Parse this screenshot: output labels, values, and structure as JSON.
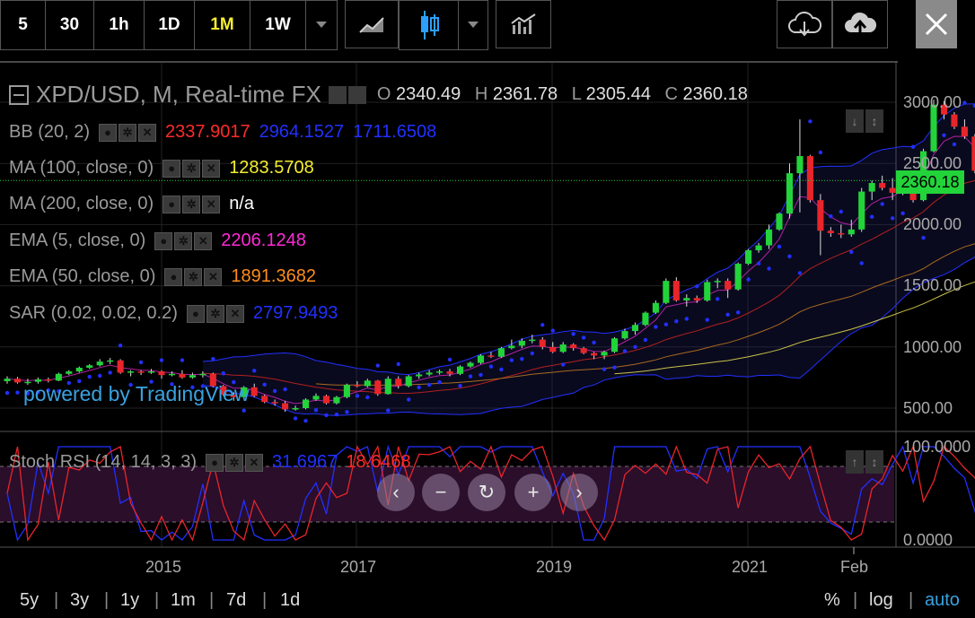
{
  "toolbar": {
    "intervals": [
      {
        "label": "5",
        "active": false
      },
      {
        "label": "30",
        "active": false
      },
      {
        "label": "1h",
        "active": false
      },
      {
        "label": "1D",
        "active": false
      },
      {
        "label": "1M",
        "active": true
      },
      {
        "label": "1W",
        "active": false
      }
    ]
  },
  "header": {
    "symbol": "XPD/USD, M, Real-time FX",
    "open_label": "O",
    "open": "2340.49",
    "high_label": "H",
    "high": "2361.78",
    "low_label": "L",
    "low": "2305.44",
    "close_label": "C",
    "close": "2360.18"
  },
  "indicators": [
    {
      "name": "BB (20, 2)",
      "values": [
        {
          "text": "2337.9017",
          "color": "#ff2a2a"
        },
        {
          "text": "2964.1527",
          "color": "#2230ff"
        },
        {
          "text": "1711.6508",
          "color": "#2230ff"
        }
      ]
    },
    {
      "name": "MA (100, close, 0)",
      "values": [
        {
          "text": "1283.5708",
          "color": "#f5ef2d"
        }
      ]
    },
    {
      "name": "MA (200, close, 0)",
      "values": [
        {
          "text": "n/a",
          "color": "#ffffff"
        }
      ]
    },
    {
      "name": "EMA (5, close, 0)",
      "values": [
        {
          "text": "2206.1248",
          "color": "#ff2ad8"
        }
      ]
    },
    {
      "name": "EMA (50, close, 0)",
      "values": [
        {
          "text": "1891.3682",
          "color": "#ff8c1a"
        }
      ]
    },
    {
      "name": "SAR (0.02, 0.02, 0.2)",
      "values": [
        {
          "text": "2797.9493",
          "color": "#2230ff"
        }
      ]
    }
  ],
  "stoch": {
    "name": "Stoch RSI (14, 14, 3, 3)",
    "k": "31.6967",
    "k_color": "#2230ff",
    "d": "18.6468",
    "d_color": "#ff2a2a"
  },
  "watermark": "powered by TradingView",
  "last_price": "2360.18",
  "price_axis": [
    "3000.00",
    "2500.00",
    "2000.00",
    "1500.00",
    "1000.00",
    "500.00"
  ],
  "stoch_axis": [
    "100.0000",
    "0.0000"
  ],
  "time_axis": [
    "2015",
    "2017",
    "2019",
    "2021",
    "Feb"
  ],
  "range_bar": {
    "left": [
      "5y",
      "3y",
      "1y",
      "1m",
      "7d",
      "1d"
    ],
    "right": [
      "%",
      "log",
      "auto"
    ]
  },
  "colors": {
    "up": "#22d33a",
    "down": "#e8252a",
    "active_interval": "#f5ef2d",
    "auto": "#3aa2e0"
  },
  "chart_data": {
    "type": "candlestick",
    "symbol": "XPD/USD",
    "interval": "1M",
    "ylim": [
      350,
      3150
    ],
    "candles": [
      {
        "t": "2013-10",
        "o": 720,
        "h": 760,
        "l": 700,
        "c": 740
      },
      {
        "t": "2013-11",
        "o": 740,
        "h": 755,
        "l": 700,
        "c": 710
      },
      {
        "t": "2013-12",
        "o": 710,
        "h": 740,
        "l": 690,
        "c": 715
      },
      {
        "t": "2014-01",
        "o": 715,
        "h": 750,
        "l": 700,
        "c": 735
      },
      {
        "t": "2014-02",
        "o": 735,
        "h": 750,
        "l": 710,
        "c": 725
      },
      {
        "t": "2014-03",
        "o": 725,
        "h": 790,
        "l": 720,
        "c": 780
      },
      {
        "t": "2014-04",
        "o": 780,
        "h": 810,
        "l": 770,
        "c": 800
      },
      {
        "t": "2014-05",
        "o": 800,
        "h": 840,
        "l": 790,
        "c": 830
      },
      {
        "t": "2014-06",
        "o": 830,
        "h": 860,
        "l": 820,
        "c": 850
      },
      {
        "t": "2014-07",
        "o": 850,
        "h": 900,
        "l": 840,
        "c": 880
      },
      {
        "t": "2014-08",
        "o": 880,
        "h": 910,
        "l": 860,
        "c": 890
      },
      {
        "t": "2014-09",
        "o": 890,
        "h": 900,
        "l": 780,
        "c": 790
      },
      {
        "t": "2014-10",
        "o": 790,
        "h": 810,
        "l": 760,
        "c": 800
      },
      {
        "t": "2014-11",
        "o": 800,
        "h": 810,
        "l": 770,
        "c": 790
      },
      {
        "t": "2014-12",
        "o": 790,
        "h": 820,
        "l": 780,
        "c": 800
      },
      {
        "t": "2015-01",
        "o": 800,
        "h": 810,
        "l": 740,
        "c": 770
      },
      {
        "t": "2015-02",
        "o": 770,
        "h": 800,
        "l": 760,
        "c": 780
      },
      {
        "t": "2015-03",
        "o": 780,
        "h": 810,
        "l": 740,
        "c": 750
      },
      {
        "t": "2015-04",
        "o": 750,
        "h": 790,
        "l": 740,
        "c": 770
      },
      {
        "t": "2015-05",
        "o": 770,
        "h": 800,
        "l": 750,
        "c": 780
      },
      {
        "t": "2015-06",
        "o": 780,
        "h": 790,
        "l": 670,
        "c": 680
      },
      {
        "t": "2015-07",
        "o": 680,
        "h": 690,
        "l": 600,
        "c": 610
      },
      {
        "t": "2015-08",
        "o": 610,
        "h": 630,
        "l": 560,
        "c": 590
      },
      {
        "t": "2015-09",
        "o": 590,
        "h": 680,
        "l": 580,
        "c": 670
      },
      {
        "t": "2015-10",
        "o": 670,
        "h": 700,
        "l": 590,
        "c": 600
      },
      {
        "t": "2015-11",
        "o": 600,
        "h": 610,
        "l": 540,
        "c": 550
      },
      {
        "t": "2015-12",
        "o": 550,
        "h": 570,
        "l": 520,
        "c": 540
      },
      {
        "t": "2016-01",
        "o": 540,
        "h": 560,
        "l": 470,
        "c": 490
      },
      {
        "t": "2016-02",
        "o": 490,
        "h": 520,
        "l": 480,
        "c": 500
      },
      {
        "t": "2016-03",
        "o": 500,
        "h": 580,
        "l": 490,
        "c": 570
      },
      {
        "t": "2016-04",
        "o": 570,
        "h": 620,
        "l": 560,
        "c": 600
      },
      {
        "t": "2016-05",
        "o": 600,
        "h": 610,
        "l": 530,
        "c": 540
      },
      {
        "t": "2016-06",
        "o": 540,
        "h": 600,
        "l": 530,
        "c": 590
      },
      {
        "t": "2016-07",
        "o": 590,
        "h": 700,
        "l": 580,
        "c": 690
      },
      {
        "t": "2016-08",
        "o": 690,
        "h": 720,
        "l": 670,
        "c": 680
      },
      {
        "t": "2016-09",
        "o": 680,
        "h": 740,
        "l": 670,
        "c": 725
      },
      {
        "t": "2016-10",
        "o": 725,
        "h": 730,
        "l": 600,
        "c": 615
      },
      {
        "t": "2016-11",
        "o": 615,
        "h": 760,
        "l": 610,
        "c": 740
      },
      {
        "t": "2016-12",
        "o": 740,
        "h": 760,
        "l": 660,
        "c": 680
      },
      {
        "t": "2017-01",
        "o": 680,
        "h": 770,
        "l": 670,
        "c": 760
      },
      {
        "t": "2017-02",
        "o": 760,
        "h": 790,
        "l": 740,
        "c": 775
      },
      {
        "t": "2017-03",
        "o": 775,
        "h": 810,
        "l": 760,
        "c": 790
      },
      {
        "t": "2017-04",
        "o": 790,
        "h": 815,
        "l": 775,
        "c": 800
      },
      {
        "t": "2017-05",
        "o": 800,
        "h": 820,
        "l": 760,
        "c": 780
      },
      {
        "t": "2017-06",
        "o": 780,
        "h": 850,
        "l": 770,
        "c": 840
      },
      {
        "t": "2017-07",
        "o": 840,
        "h": 880,
        "l": 830,
        "c": 870
      },
      {
        "t": "2017-08",
        "o": 870,
        "h": 940,
        "l": 860,
        "c": 930
      },
      {
        "t": "2017-09",
        "o": 930,
        "h": 960,
        "l": 910,
        "c": 920
      },
      {
        "t": "2017-10",
        "o": 920,
        "h": 1000,
        "l": 910,
        "c": 990
      },
      {
        "t": "2017-11",
        "o": 990,
        "h": 1060,
        "l": 980,
        "c": 1010
      },
      {
        "t": "2017-12",
        "o": 1010,
        "h": 1070,
        "l": 990,
        "c": 1050
      },
      {
        "t": "2018-01",
        "o": 1050,
        "h": 1100,
        "l": 1030,
        "c": 1060
      },
      {
        "t": "2018-02",
        "o": 1060,
        "h": 1080,
        "l": 980,
        "c": 1000
      },
      {
        "t": "2018-03",
        "o": 1000,
        "h": 1040,
        "l": 950,
        "c": 960
      },
      {
        "t": "2018-04",
        "o": 960,
        "h": 1040,
        "l": 950,
        "c": 1020
      },
      {
        "t": "2018-05",
        "o": 1020,
        "h": 1030,
        "l": 970,
        "c": 990
      },
      {
        "t": "2018-06",
        "o": 990,
        "h": 1000,
        "l": 940,
        "c": 950
      },
      {
        "t": "2018-07",
        "o": 950,
        "h": 960,
        "l": 900,
        "c": 930
      },
      {
        "t": "2018-08",
        "o": 930,
        "h": 970,
        "l": 900,
        "c": 960
      },
      {
        "t": "2018-09",
        "o": 960,
        "h": 1080,
        "l": 950,
        "c": 1070
      },
      {
        "t": "2018-10",
        "o": 1070,
        "h": 1150,
        "l": 1060,
        "c": 1130
      },
      {
        "t": "2018-11",
        "o": 1130,
        "h": 1200,
        "l": 1100,
        "c": 1180
      },
      {
        "t": "2018-12",
        "o": 1180,
        "h": 1290,
        "l": 1170,
        "c": 1280
      },
      {
        "t": "2019-01",
        "o": 1280,
        "h": 1380,
        "l": 1270,
        "c": 1360
      },
      {
        "t": "2019-02",
        "o": 1360,
        "h": 1560,
        "l": 1350,
        "c": 1540
      },
      {
        "t": "2019-03",
        "o": 1540,
        "h": 1570,
        "l": 1370,
        "c": 1380
      },
      {
        "t": "2019-04",
        "o": 1380,
        "h": 1430,
        "l": 1330,
        "c": 1400
      },
      {
        "t": "2019-05",
        "o": 1400,
        "h": 1420,
        "l": 1360,
        "c": 1380
      },
      {
        "t": "2019-06",
        "o": 1380,
        "h": 1550,
        "l": 1370,
        "c": 1530
      },
      {
        "t": "2019-07",
        "o": 1530,
        "h": 1560,
        "l": 1480,
        "c": 1540
      },
      {
        "t": "2019-08",
        "o": 1540,
        "h": 1560,
        "l": 1400,
        "c": 1470
      },
      {
        "t": "2019-09",
        "o": 1470,
        "h": 1690,
        "l": 1460,
        "c": 1680
      },
      {
        "t": "2019-10",
        "o": 1680,
        "h": 1800,
        "l": 1670,
        "c": 1790
      },
      {
        "t": "2019-11",
        "o": 1790,
        "h": 1850,
        "l": 1770,
        "c": 1830
      },
      {
        "t": "2019-12",
        "o": 1830,
        "h": 2000,
        "l": 1800,
        "c": 1960
      },
      {
        "t": "2020-01",
        "o": 1960,
        "h": 2100,
        "l": 1950,
        "c": 2090
      },
      {
        "t": "2020-02",
        "o": 2090,
        "h": 2500,
        "l": 2050,
        "c": 2420
      },
      {
        "t": "2020-03",
        "o": 2420,
        "h": 2860,
        "l": 2100,
        "c": 2560
      },
      {
        "t": "2020-04",
        "o": 2560,
        "h": 2570,
        "l": 2180,
        "c": 2200
      },
      {
        "t": "2020-05",
        "o": 2200,
        "h": 2250,
        "l": 1750,
        "c": 1950
      },
      {
        "t": "2020-06",
        "o": 1950,
        "h": 1980,
        "l": 1900,
        "c": 1930
      },
      {
        "t": "2020-07",
        "o": 1930,
        "h": 2000,
        "l": 1890,
        "c": 1920
      },
      {
        "t": "2020-08",
        "o": 1920,
        "h": 2040,
        "l": 1900,
        "c": 1960
      },
      {
        "t": "2020-09",
        "o": 1960,
        "h": 2300,
        "l": 1940,
        "c": 2270
      },
      {
        "t": "2020-10",
        "o": 2270,
        "h": 2360,
        "l": 2200,
        "c": 2340
      },
      {
        "t": "2020-11",
        "o": 2340,
        "h": 2400,
        "l": 2280,
        "c": 2300
      },
      {
        "t": "2020-12",
        "o": 2300,
        "h": 2380,
        "l": 2200,
        "c": 2260
      },
      {
        "t": "2021-01",
        "o": 2260,
        "h": 2420,
        "l": 2240,
        "c": 2380
      },
      {
        "t": "2021-02",
        "o": 2380,
        "h": 2440,
        "l": 2180,
        "c": 2200
      },
      {
        "t": "2021-03",
        "o": 2200,
        "h": 2620,
        "l": 2190,
        "c": 2600
      },
      {
        "t": "2021-04",
        "o": 2600,
        "h": 3020,
        "l": 2590,
        "c": 2980
      },
      {
        "t": "2021-05",
        "o": 2980,
        "h": 3010,
        "l": 2860,
        "c": 2900
      },
      {
        "t": "2021-06",
        "o": 2900,
        "h": 2920,
        "l": 2780,
        "c": 2800
      },
      {
        "t": "2021-07",
        "o": 2800,
        "h": 2860,
        "l": 2700,
        "c": 2720
      },
      {
        "t": "2021-08",
        "o": 2720,
        "h": 2740,
        "l": 2420,
        "c": 2440
      },
      {
        "t": "2021-09",
        "o": 2440,
        "h": 2460,
        "l": 1900,
        "c": 1920
      },
      {
        "t": "2021-10",
        "o": 1920,
        "h": 2070,
        "l": 1880,
        "c": 2030
      },
      {
        "t": "2021-11",
        "o": 2030,
        "h": 2060,
        "l": 1680,
        "c": 1800
      },
      {
        "t": "2021-12",
        "o": 1800,
        "h": 1980,
        "l": 1730,
        "c": 1940
      },
      {
        "t": "2022-01",
        "o": 1940,
        "h": 2440,
        "l": 1900,
        "c": 2340
      },
      {
        "t": "2022-02",
        "o": 2340.49,
        "h": 2361.78,
        "l": 2305.44,
        "c": 2360.18
      }
    ]
  }
}
